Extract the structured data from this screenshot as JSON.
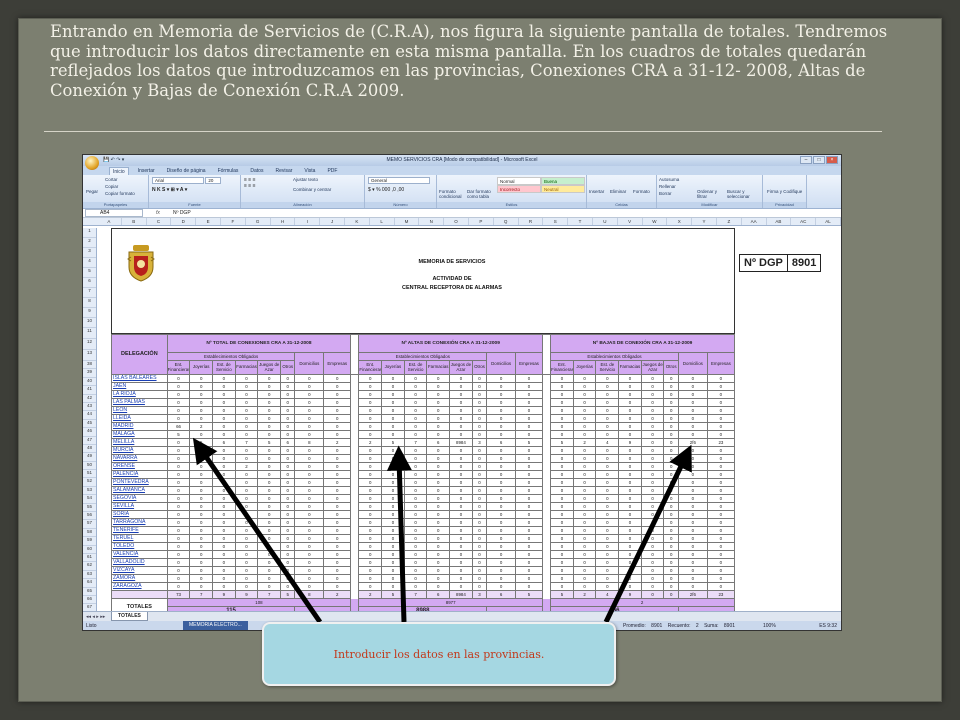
{
  "slide": {
    "title": "Entrando en Memoria de Servicios de (C.R.A), nos figura la siguiente pantalla de totales. Tendremos que introducir los datos directamente en esta misma pantalla. En los cuadros de totales quedarán reflejados los datos que introduzcamos en las provincias, Conexiones CRA a 31-12- 2008, Altas de Conexión y Bajas de Conexión C.R.A 2009.",
    "callout": "Introducir los datos en las provincias."
  },
  "excel": {
    "window_title": "MEMO SERVICIOS CRA [Modo de compatibilidad] - Microsoft Excel",
    "tabs": [
      "Inicio",
      "Insertar",
      "Diseño de página",
      "Fórmulas",
      "Datos",
      "Revisar",
      "Vista",
      "PDF"
    ],
    "ribbon": {
      "portapapeles": {
        "label": "Portapapeles",
        "pegar": "Pegar",
        "cortar": "Cortar",
        "copiar": "Copiar",
        "copiar_formato": "Copiar formato"
      },
      "fuente": {
        "label": "Fuente",
        "font": "Arial",
        "size": "20"
      },
      "alineacion": {
        "label": "Alineación",
        "ajustar": "Ajustar texto",
        "combinar": "Combinar y centrar"
      },
      "numero": {
        "label": "Número",
        "format": "General"
      },
      "estilos": {
        "label": "Estilos",
        "formato_condicional": "Formato condicional",
        "dar_formato": "Dar formato como tabla",
        "normal": "Normal",
        "buena": "Buena",
        "incorrecto": "Incorrecto",
        "neutral": "Neutral"
      },
      "celdas": {
        "label": "Celdas",
        "insertar": "Insertar",
        "eliminar": "Eliminar",
        "formato": "Formato"
      },
      "modificar": {
        "label": "Modificar",
        "autosuma": "Autosuma",
        "rellenar": "Rellenar",
        "borrar": "Borrar",
        "ordenar": "Ordenar y filtrar",
        "buscar": "Buscar y seleccionar"
      },
      "privacidad": {
        "label": "Privacidad",
        "firma": "Firma y Codifique"
      }
    },
    "name_box": "AB4",
    "formula": "Nº DGP",
    "columns": [
      "A",
      "B",
      "C",
      "D",
      "E",
      "F",
      "G",
      "H",
      "I",
      "J",
      "K",
      "L",
      "M",
      "N",
      "O",
      "P",
      "Q",
      "R",
      "S",
      "T",
      "U",
      "V",
      "W",
      "X",
      "Y",
      "Z",
      "AA",
      "AB",
      "AC",
      "AL"
    ],
    "row_numbers": [
      "1",
      "2",
      "3",
      "4",
      "5",
      "6",
      "7",
      "8",
      "9",
      "10",
      "11",
      "12",
      "13",
      "38",
      "39",
      "40",
      "41",
      "42",
      "43",
      "44",
      "45",
      "46",
      "47",
      "48",
      "49",
      "50",
      "51",
      "52",
      "53",
      "54",
      "55",
      "56",
      "57",
      "58",
      "59",
      "60",
      "61",
      "62",
      "63",
      "64",
      "65",
      "66",
      "67"
    ],
    "memoria": {
      "line1": "MEMORIA DE SERVICIOS",
      "line2": "ACTIVIDAD DE",
      "line3": "CENTRAL RECEPTORA DE ALARMAS"
    },
    "dgp": {
      "label": "Nº DGP",
      "value": "8901"
    },
    "headers": {
      "delegacion": "DELEGACIÓN",
      "group1": "Nº TOTAL DE CONEXIONES CRA A 31-12-2008",
      "group2": "Nº ALTAS DE CONEXIÓN CRA A 31-12-2009",
      "group3": "Nº BAJAS DE CONEXIÓN CRA A 31-12-2009",
      "establecimientos": "Establecimientos Obligados",
      "sub": [
        "Ent. Financieras",
        "Joyerías",
        "Est. de Servicio",
        "Farmacias",
        "Juegos de Azar",
        "Otros"
      ],
      "domicilios": "Domicilios",
      "empresas": "Empresas"
    },
    "provinces": [
      {
        "name": "ISLAS BALEARES",
        "v": [
          "0",
          "0",
          "0",
          "0",
          "0",
          "0",
          "0",
          "0",
          "0",
          "0",
          "0",
          "0",
          "0",
          "0",
          "0",
          "0",
          "0",
          "0",
          "0",
          "0",
          "0",
          "0",
          "0",
          "0"
        ]
      },
      {
        "name": "JAÉN",
        "v": [
          "0",
          "0",
          "0",
          "0",
          "0",
          "0",
          "0",
          "0",
          "0",
          "0",
          "0",
          "0",
          "0",
          "0",
          "0",
          "0",
          "0",
          "0",
          "0",
          "0",
          "0",
          "0",
          "0",
          "0"
        ]
      },
      {
        "name": "LA RIOJA",
        "v": [
          "0",
          "0",
          "0",
          "0",
          "0",
          "0",
          "0",
          "0",
          "0",
          "0",
          "0",
          "0",
          "0",
          "0",
          "0",
          "0",
          "0",
          "0",
          "0",
          "0",
          "0",
          "0",
          "0",
          "0"
        ]
      },
      {
        "name": "LAS PALMAS",
        "v": [
          "0",
          "0",
          "0",
          "0",
          "0",
          "0",
          "0",
          "0",
          "0",
          "0",
          "0",
          "0",
          "0",
          "0",
          "0",
          "0",
          "0",
          "0",
          "0",
          "0",
          "0",
          "0",
          "0",
          "0"
        ]
      },
      {
        "name": "LEÓN",
        "v": [
          "0",
          "0",
          "0",
          "0",
          "0",
          "0",
          "0",
          "0",
          "0",
          "0",
          "0",
          "0",
          "0",
          "0",
          "0",
          "0",
          "0",
          "0",
          "0",
          "0",
          "0",
          "0",
          "0",
          "0"
        ]
      },
      {
        "name": "LLEIDA",
        "v": [
          "0",
          "0",
          "0",
          "0",
          "0",
          "0",
          "0",
          "0",
          "0",
          "0",
          "0",
          "0",
          "0",
          "0",
          "0",
          "0",
          "0",
          "0",
          "0",
          "0",
          "0",
          "0",
          "0",
          "0"
        ]
      },
      {
        "name": "MADRID",
        "v": [
          "66",
          "2",
          "0",
          "0",
          "0",
          "0",
          "0",
          "0",
          "0",
          "0",
          "0",
          "0",
          "0",
          "0",
          "0",
          "0",
          "0",
          "0",
          "0",
          "0",
          "0",
          "0",
          "0",
          "0"
        ]
      },
      {
        "name": "MÁLAGA",
        "v": [
          "5",
          "0",
          "0",
          "0",
          "0",
          "0",
          "0",
          "0",
          "0",
          "0",
          "0",
          "0",
          "0",
          "0",
          "0",
          "0",
          "0",
          "0",
          "0",
          "0",
          "0",
          "0",
          "0",
          "0"
        ]
      },
      {
        "name": "MELILLA",
        "v": [
          "0",
          "5",
          "6",
          "7",
          "5",
          "6",
          "8",
          "2",
          "2",
          "5",
          "7",
          "6",
          "8984",
          "3",
          "6",
          "5",
          "5",
          "2",
          "4",
          "9",
          "0",
          "0",
          "2f6",
          "23"
        ]
      },
      {
        "name": "MURCIA",
        "v": [
          "0",
          "0",
          "0",
          "0",
          "0",
          "0",
          "0",
          "0",
          "0",
          "0",
          "0",
          "0",
          "0",
          "0",
          "0",
          "0",
          "0",
          "0",
          "0",
          "0",
          "0",
          "0",
          "0",
          "0"
        ]
      },
      {
        "name": "NAVARRA",
        "v": [
          "0",
          "0",
          "0",
          "0",
          "0",
          "0",
          "0",
          "0",
          "0",
          "0",
          "0",
          "0",
          "0",
          "0",
          "0",
          "0",
          "0",
          "0",
          "0",
          "0",
          "0",
          "0",
          "0",
          "0"
        ]
      },
      {
        "name": "ORENSE",
        "v": [
          "0",
          "0",
          "0",
          "2",
          "0",
          "0",
          "0",
          "0",
          "0",
          "0",
          "0",
          "0",
          "0",
          "0",
          "0",
          "0",
          "0",
          "0",
          "0",
          "0",
          "0",
          "0",
          "0",
          "0"
        ]
      },
      {
        "name": "PALENCIA",
        "v": [
          "0",
          "0",
          "0",
          "0",
          "0",
          "0",
          "0",
          "0",
          "0",
          "0",
          "0",
          "0",
          "0",
          "0",
          "0",
          "0",
          "0",
          "0",
          "0",
          "0",
          "0",
          "0",
          "0",
          "0"
        ]
      },
      {
        "name": "PONTEVEDRA",
        "v": [
          "0",
          "0",
          "0",
          "0",
          "0",
          "0",
          "0",
          "0",
          "0",
          "0",
          "0",
          "0",
          "0",
          "0",
          "0",
          "0",
          "0",
          "0",
          "0",
          "0",
          "0",
          "0",
          "0",
          "0"
        ]
      },
      {
        "name": "SALAMANCA",
        "v": [
          "0",
          "0",
          "0",
          "0",
          "0",
          "0",
          "0",
          "0",
          "0",
          "0",
          "0",
          "0",
          "0",
          "0",
          "0",
          "0",
          "0",
          "0",
          "0",
          "0",
          "0",
          "0",
          "0",
          "0"
        ]
      },
      {
        "name": "SEGOVIA",
        "v": [
          "0",
          "0",
          "0",
          "0",
          "0",
          "0",
          "0",
          "0",
          "0",
          "0",
          "0",
          "0",
          "0",
          "0",
          "0",
          "0",
          "0",
          "0",
          "0",
          "0",
          "0",
          "0",
          "0",
          "0"
        ]
      },
      {
        "name": "SEVILLA",
        "v": [
          "0",
          "0",
          "0",
          "0",
          "0",
          "0",
          "0",
          "0",
          "0",
          "0",
          "0",
          "0",
          "0",
          "0",
          "0",
          "0",
          "0",
          "0",
          "0",
          "0",
          "0",
          "0",
          "0",
          "0"
        ]
      },
      {
        "name": "SORIA",
        "v": [
          "0",
          "0",
          "0",
          "0",
          "0",
          "0",
          "0",
          "0",
          "0",
          "0",
          "0",
          "0",
          "0",
          "0",
          "0",
          "0",
          "0",
          "0",
          "0",
          "0",
          "0",
          "0",
          "0",
          "0"
        ]
      },
      {
        "name": "TARRAGONA",
        "v": [
          "0",
          "0",
          "0",
          "0",
          "0",
          "0",
          "0",
          "0",
          "0",
          "0",
          "0",
          "0",
          "0",
          "0",
          "0",
          "0",
          "0",
          "0",
          "0",
          "0",
          "0",
          "0",
          "0",
          "0"
        ]
      },
      {
        "name": "TENERIFE",
        "v": [
          "0",
          "0",
          "0",
          "0",
          "0",
          "0",
          "0",
          "0",
          "0",
          "0",
          "0",
          "0",
          "0",
          "0",
          "0",
          "0",
          "0",
          "0",
          "0",
          "0",
          "0",
          "0",
          "0",
          "0"
        ]
      },
      {
        "name": "TERUEL",
        "v": [
          "0",
          "0",
          "0",
          "0",
          "0",
          "0",
          "0",
          "0",
          "0",
          "0",
          "0",
          "0",
          "0",
          "0",
          "0",
          "0",
          "0",
          "0",
          "0",
          "0",
          "0",
          "0",
          "0",
          "0"
        ]
      },
      {
        "name": "TOLEDO",
        "v": [
          "0",
          "0",
          "0",
          "0",
          "0",
          "0",
          "0",
          "0",
          "0",
          "0",
          "0",
          "0",
          "0",
          "0",
          "0",
          "0",
          "0",
          "0",
          "0",
          "0",
          "0",
          "0",
          "0",
          "0"
        ]
      },
      {
        "name": "VALENCIA",
        "v": [
          "0",
          "0",
          "0",
          "0",
          "0",
          "0",
          "0",
          "0",
          "0",
          "0",
          "0",
          "0",
          "0",
          "0",
          "0",
          "0",
          "0",
          "0",
          "0",
          "0",
          "0",
          "0",
          "0",
          "0"
        ]
      },
      {
        "name": "VALLADOLID",
        "v": [
          "0",
          "0",
          "0",
          "0",
          "0",
          "0",
          "0",
          "0",
          "0",
          "0",
          "0",
          "0",
          "0",
          "0",
          "0",
          "0",
          "0",
          "0",
          "0",
          "0",
          "0",
          "0",
          "0",
          "0"
        ]
      },
      {
        "name": "VIZCAYA",
        "v": [
          "0",
          "0",
          "0",
          "0",
          "0",
          "0",
          "0",
          "0",
          "0",
          "0",
          "0",
          "0",
          "0",
          "0",
          "0",
          "0",
          "0",
          "0",
          "0",
          "0",
          "0",
          "0",
          "0",
          "0"
        ]
      },
      {
        "name": "ZAMORA",
        "v": [
          "0",
          "0",
          "0",
          "0",
          "0",
          "0",
          "0",
          "0",
          "0",
          "0",
          "0",
          "0",
          "0",
          "0",
          "0",
          "0",
          "0",
          "0",
          "0",
          "0",
          "0",
          "0",
          "0",
          "0"
        ]
      },
      {
        "name": "ZARAGOZA",
        "v": [
          "0",
          "0",
          "0",
          "0",
          "0",
          "0",
          "0",
          "0",
          "0",
          "0",
          "0",
          "0",
          "0",
          "0",
          "0",
          "0",
          "0",
          "0",
          "0",
          "0",
          "0",
          "0",
          "0",
          "0"
        ]
      }
    ],
    "subtotals": [
      "73",
      "7",
      "9",
      "9",
      "7",
      "5",
      "8",
      "2",
      "2",
      "5",
      "7",
      "6",
      "8984",
      "3",
      "6",
      "5",
      "5",
      "2",
      "4",
      "9",
      "0",
      "0",
      "2f6",
      "23"
    ],
    "totals": {
      "label": "TOTALES",
      "g1_estab": "108",
      "g1_all": "115",
      "g2_estab": "8977",
      "g2_all": "8988",
      "g3_estab": "2 ",
      "g3_all": "266"
    },
    "sheet_tab": "TOTALES",
    "status": {
      "left": "Listo",
      "promedio": "Promedio: 8901",
      "recuento": "Recuento: 2",
      "suma": "Suma: 8901",
      "zoom": "100%",
      "taskbar": "MEMORIA ELECTRO...",
      "lang": "ES",
      "clock": "9:32"
    }
  }
}
